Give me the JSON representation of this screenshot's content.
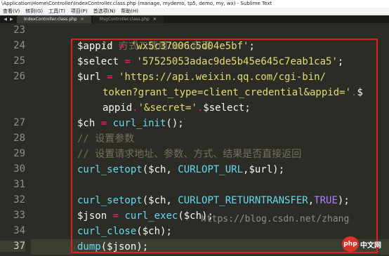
{
  "window": {
    "title": "\\Application\\Home\\Controller\\IndexController.class.php (manage, mydemo, tp5, demo, my, wx) - Sublime Text"
  },
  "menu": [
    "查看(V)",
    "转到(G)",
    "工具(T)",
    "项目(P)",
    "首选项(N)",
    "帮助(H)"
  ],
  "tabs": [
    {
      "label": "IndexController.class.php",
      "active": true
    },
    {
      "label": "MsgController.class.php",
      "active": false
    }
  ],
  "gutter": {
    "line_numbers": [
      "23",
      "24",
      "25",
      "26",
      "27",
      "28",
      "29",
      "30",
      "31",
      "32",
      "33",
      "34",
      "35",
      "36",
      "37"
    ],
    "current": "37"
  },
  "code": {
    "l23": "// 方式二使用curl实现",
    "l24_var": "$appid",
    "l24_op": " = ",
    "l24_str": "'wx5c37006c5d04e5bf'",
    "l24_end": ";",
    "l25_var": "$select",
    "l25_op": " = ",
    "l25_str": "'57525053adac9de5b45e645c7eab1ca5'",
    "l25_end": ";",
    "l26_var": "$url",
    "l26_op": " = ",
    "l26_str1": "'https://api.weixin.qq.com/cgi-bin/",
    "l26_str2": "token?grant_type=client_credential&appid='",
    "l26_dot1": ".",
    "l26_var2": "$",
    "l26_var3": "appid",
    "l26_dot2": ".",
    "l26_str3": "'&secret='",
    "l26_dot3": ".",
    "l26_var4": "$select",
    "l26_end": ";",
    "l27_var": "$ch",
    "l27_op": " = ",
    "l27_fn": "curl_init",
    "l27_end": "();",
    "l28": "// 设置参数",
    "l29": "// 设置请求地址、参数、方式、结果是否直接返回",
    "l30_fn": "curl_setopt",
    "l30_a": "($ch, ",
    "l30_const": "CURLOPT_URL",
    "l30_b": ",$url);",
    "l32_fn": "curl_setopt",
    "l32_a": "($ch, ",
    "l32_const": "CURLOPT_RETURNTRANSFER",
    "l32_b": ",",
    "l32_const2": "TRUE",
    "l32_c": ");",
    "l34_var": "$json",
    "l34_op": " = ",
    "l34_fn": "curl_exec",
    "l34_end": "($ch);",
    "l36_fn": "curl_close",
    "l36_end": "($ch);",
    "l37_fn": "dump",
    "l37_end": "($json);"
  },
  "watermark": "https://blog.csdn.net/zhang",
  "logo": {
    "badge": "php",
    "text": "中文网"
  },
  "colors": {
    "background": "#2b2c25",
    "string": "#e6db74",
    "keyword_op": "#f92672",
    "function": "#66d9ef",
    "comment": "#75715e",
    "constant": "#ae81ff",
    "highlight_box": "#e0201e"
  }
}
